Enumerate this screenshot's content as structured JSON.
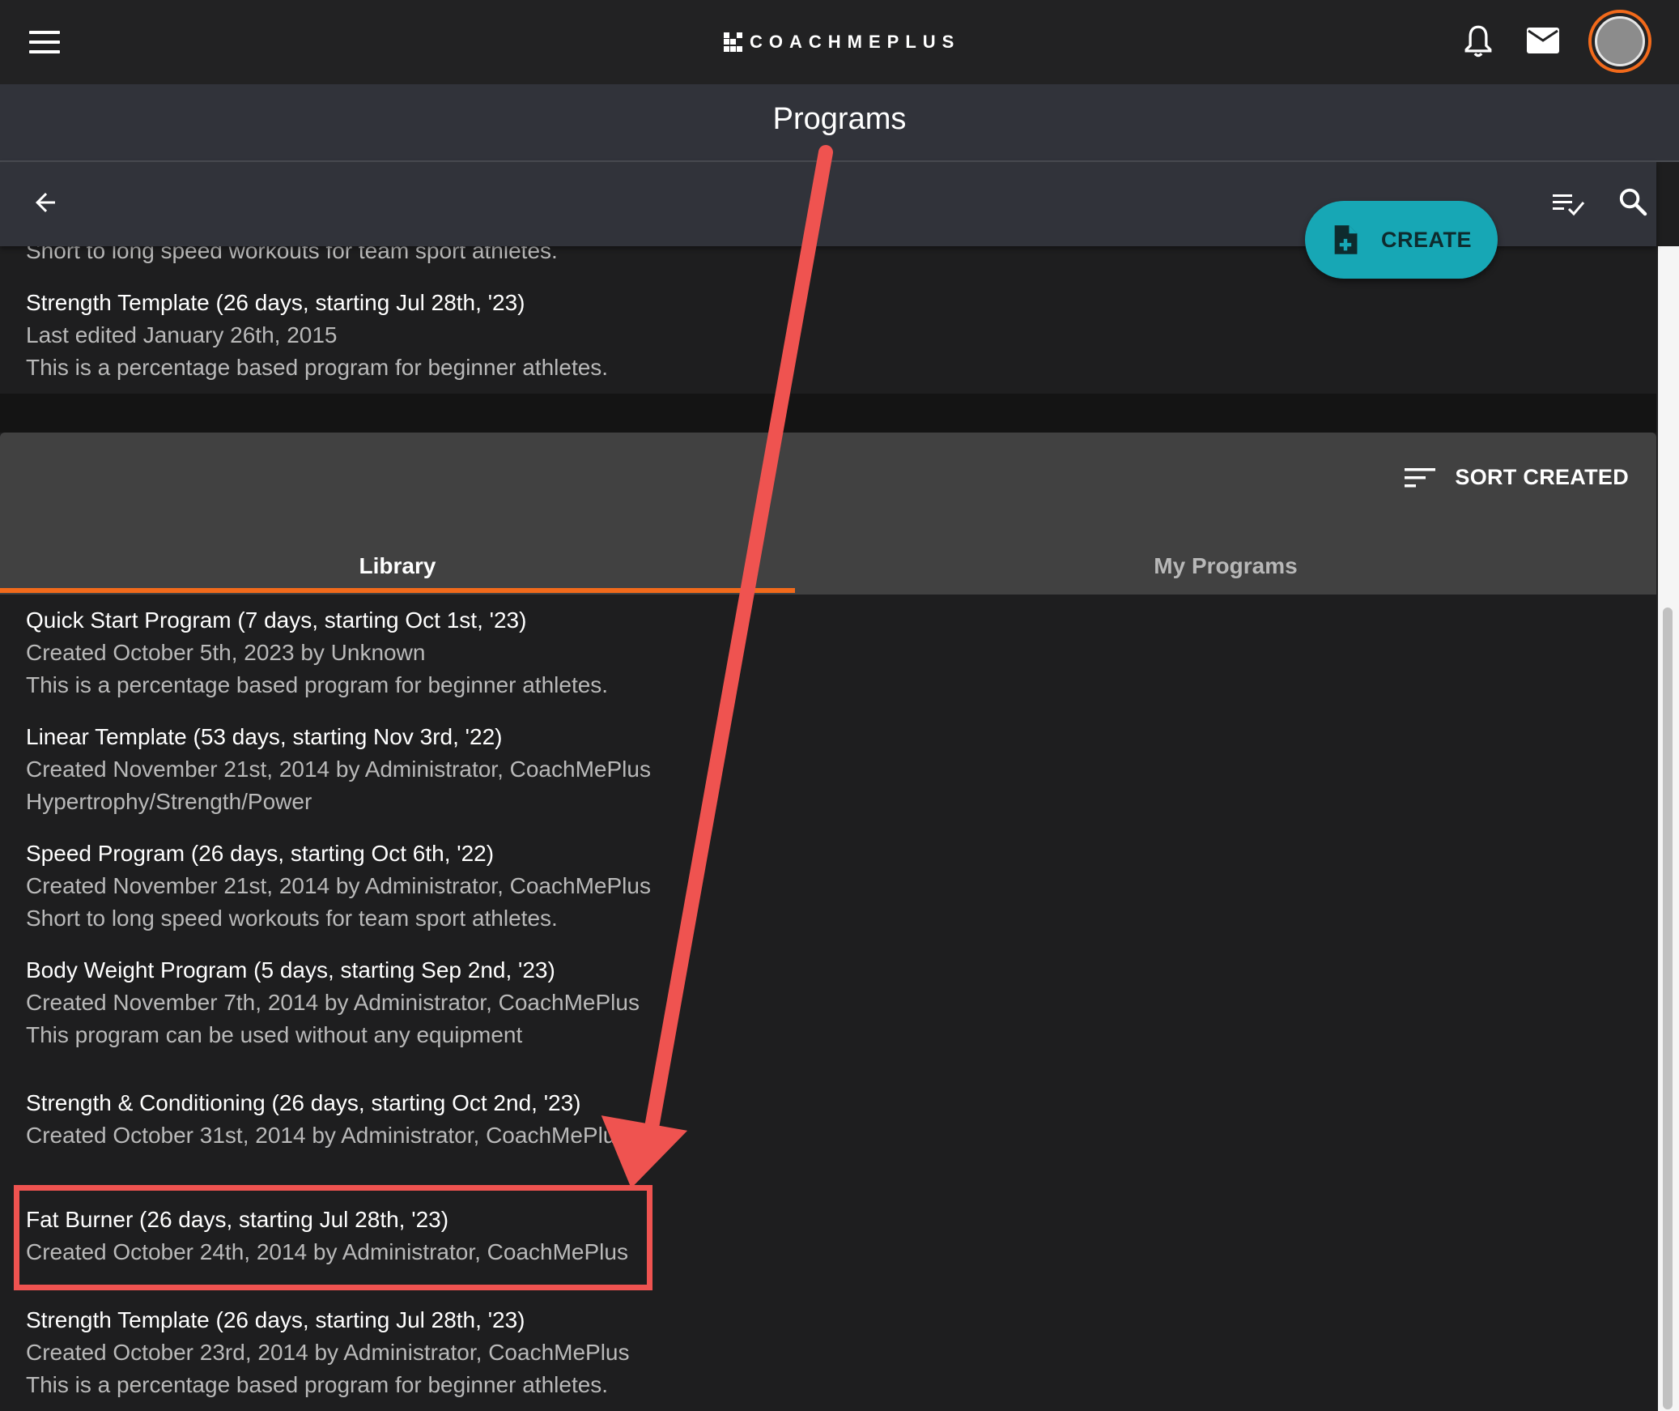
{
  "header": {
    "logo_text": "COACHMEPLUS",
    "page_title": "Programs"
  },
  "toolbar": {
    "create_label": "CREATE"
  },
  "top_items": [
    {
      "description": "Short to long speed workouts for team sport athletes."
    },
    {
      "title": "Strength Template (26 days, starting Jul 28th, '23)",
      "subtitle": "Last edited January 26th, 2015",
      "description": "This is a percentage based program for beginner athletes."
    }
  ],
  "library": {
    "sort_label": "SORT CREATED",
    "tabs": [
      {
        "label": "Library",
        "active": true
      },
      {
        "label": "My Programs",
        "active": false
      }
    ],
    "items": [
      {
        "title": "Quick Start Program (7 days, starting Oct 1st, '23)",
        "subtitle": "Created October 5th, 2023 by Unknown",
        "description": "This is a percentage based program for beginner athletes."
      },
      {
        "title": "Linear Template (53 days, starting Nov 3rd, '22)",
        "subtitle": "Created November 21st, 2014 by Administrator, CoachMePlus",
        "description": "Hypertrophy/Strength/Power"
      },
      {
        "title": "Speed Program (26 days, starting Oct 6th, '22)",
        "subtitle": "Created November 21st, 2014 by Administrator, CoachMePlus",
        "description": "Short to long speed workouts for team sport athletes."
      },
      {
        "title": "Body Weight Program (5 days, starting Sep 2nd, '23)",
        "subtitle": "Created November 7th, 2014 by Administrator, CoachMePlus",
        "description": "This program can be used without any equipment"
      },
      {
        "title": "Strength & Conditioning (26 days, starting Oct 2nd, '23)",
        "subtitle": "Created October 31st, 2014 by Administrator, CoachMePlus"
      },
      {
        "title": "Fat Burner (26 days, starting Jul 28th, '23)",
        "subtitle": "Created October 24th, 2014 by Administrator, CoachMePlus",
        "highlighted": true
      },
      {
        "title": "Strength Template (26 days, starting Jul 28th, '23)",
        "subtitle": "Created October 23rd, 2014 by Administrator, CoachMePlus",
        "description": "This is a percentage based program for beginner athletes."
      }
    ]
  },
  "colors": {
    "accent_orange": "#f26a1b",
    "create_teal": "#17a7b5",
    "annotation_red": "#ef5350"
  },
  "icons": [
    "menu-icon",
    "bell-icon",
    "mail-icon",
    "avatar",
    "back-arrow-icon",
    "list-check-icon",
    "search-icon",
    "file-plus-icon",
    "sort-icon"
  ]
}
